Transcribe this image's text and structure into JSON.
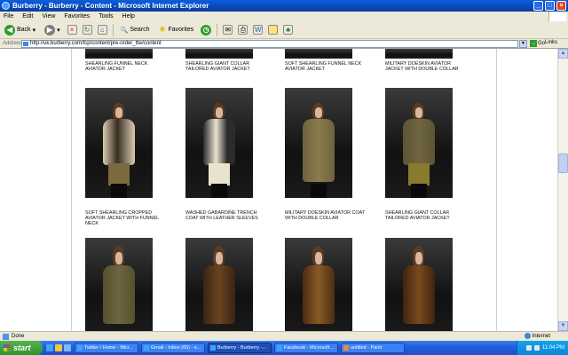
{
  "window": {
    "title": "Burberry - Burberry - Content - Microsoft Internet Explorer",
    "controls": [
      "_",
      "□",
      "×"
    ]
  },
  "menu": [
    "File",
    "Edit",
    "View",
    "Favorites",
    "Tools",
    "Help"
  ],
  "toolbar": {
    "back_label": "Back",
    "search_label": "Search",
    "favorites_label": "Favorites"
  },
  "address": {
    "label": "Address",
    "url": "http://uk.burberry.com/fcp/content/pre-order_ttw/content",
    "go_label": "Go",
    "links_label": "Links"
  },
  "content": {
    "top_captions": [
      "SHEARLING FUNNEL NECK AVIATOR JACKET",
      "SHEARLING GIANT COLLAR TAILORED AVIATOR JACKET",
      "SOFT SHEARLING FUNNEL NECK AVIATOR JACKET",
      "MILITARY DOESKIN AVIATOR JACKET WITH DOUBLE COLLAR"
    ],
    "row1_captions": [
      "SOFT SHEARLING CROPPED AVIATOR JACKET WITH FUNNEL NECK",
      "WASHED GABARDINE TRENCH COAT WITH LEATHER SLEEVES",
      "MILITARY DOESKIN AVIATOR COAT WITH DOUBLE COLLAR",
      "SHEARLING GIANT COLLAR TAILORED AVIATOR JACKET"
    ]
  },
  "statusbar": {
    "status": "Done",
    "zone": "Internet"
  },
  "taskbar": {
    "start_label": "start",
    "tasks": [
      "Twitter / Home - Micr...",
      "Gmail - Inbox (65) - s...",
      "Burberry - Burberry -...",
      "Facebook - Microsoft ...",
      "untitled - Paint"
    ],
    "active_task_index": 2,
    "clock": "11:04 PM"
  },
  "colors": {
    "titlebar": "#0a5fe0",
    "taskbar": "#245edb",
    "start": "#329032",
    "chrome": "#ece9d8"
  }
}
